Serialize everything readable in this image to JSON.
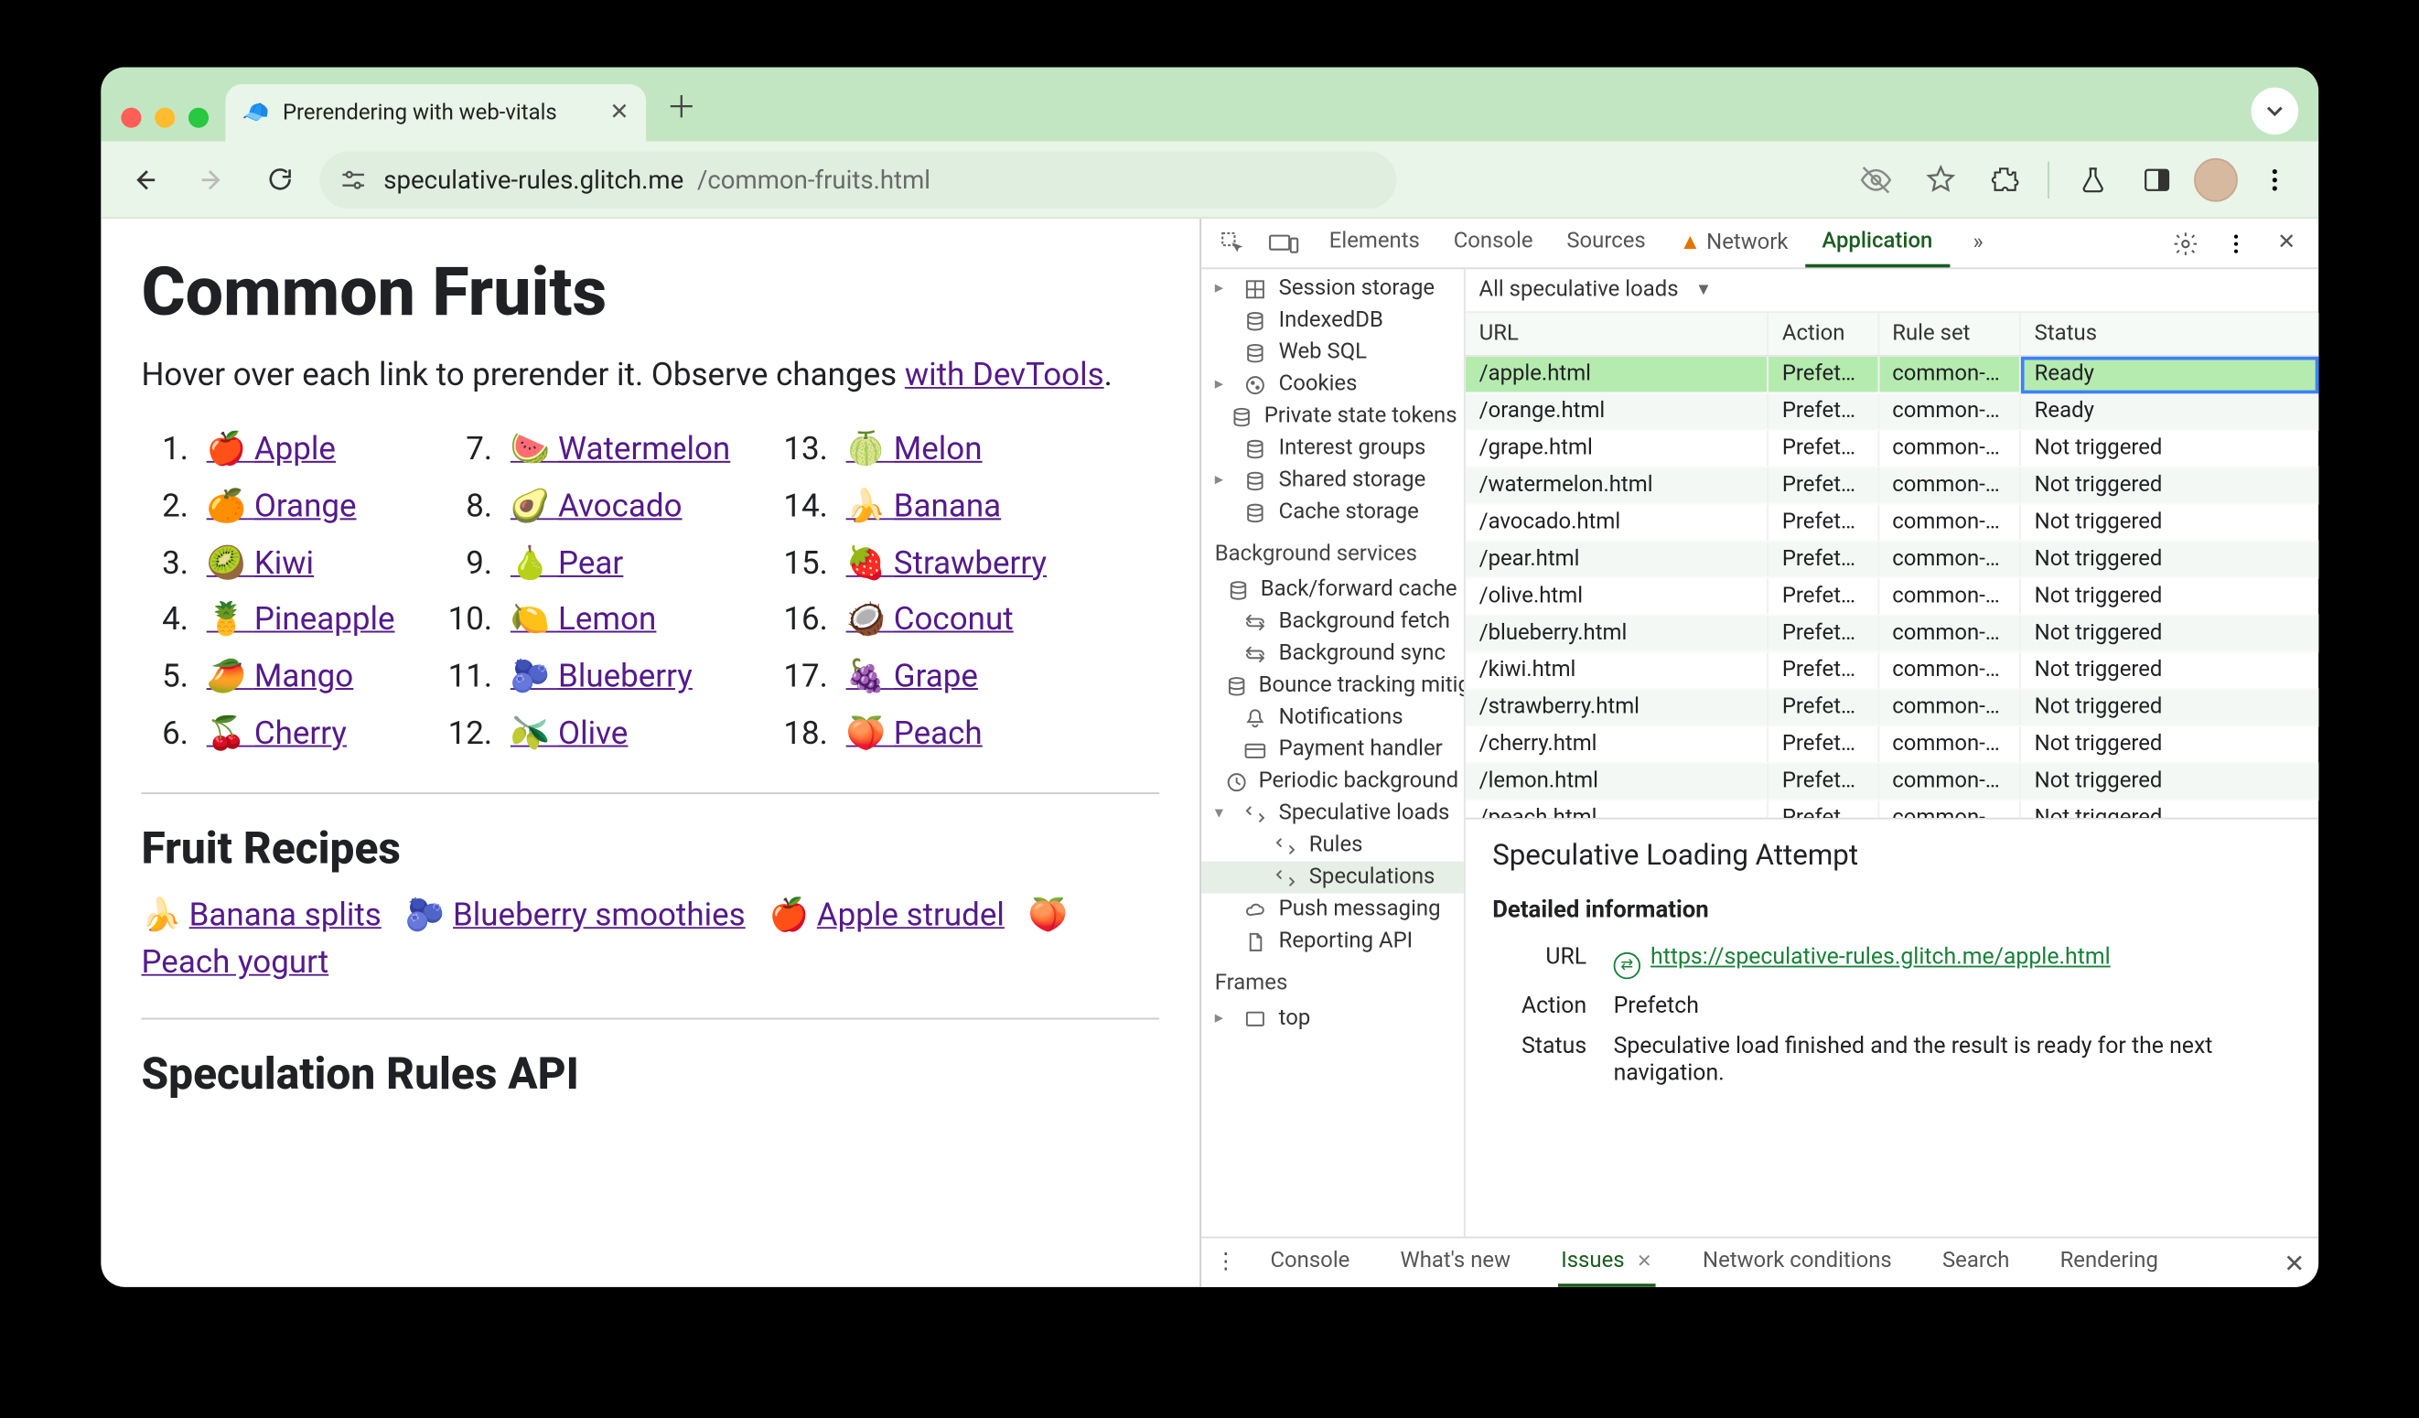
{
  "tab": {
    "title": "Prerendering with web-vitals",
    "favicon": "🧢"
  },
  "omnibox": {
    "site": "speculative-rules.glitch.me",
    "path": "/common-fruits.html"
  },
  "page": {
    "h1": "Common Fruits",
    "lead_prefix": "Hover over each link to prerender it. Observe changes ",
    "lead_link": "with DevTools",
    "lead_suffix": ".",
    "recipes_heading": "Fruit Recipes",
    "spec_heading": "Speculation Rules API",
    "fruits": [
      {
        "n": "1.",
        "e": "🍎",
        "t": "Apple"
      },
      {
        "n": "2.",
        "e": "🍊",
        "t": "Orange"
      },
      {
        "n": "3.",
        "e": "🥝",
        "t": "Kiwi"
      },
      {
        "n": "4.",
        "e": "🍍",
        "t": "Pineapple"
      },
      {
        "n": "5.",
        "e": "🥭",
        "t": "Mango"
      },
      {
        "n": "6.",
        "e": "🍒",
        "t": "Cherry"
      },
      {
        "n": "7.",
        "e": "🍉",
        "t": "Watermelon"
      },
      {
        "n": "8.",
        "e": "🥑",
        "t": "Avocado"
      },
      {
        "n": "9.",
        "e": "🍐",
        "t": "Pear"
      },
      {
        "n": "10.",
        "e": "🍋",
        "t": "Lemon"
      },
      {
        "n": "11.",
        "e": "🫐",
        "t": "Blueberry"
      },
      {
        "n": "12.",
        "e": "🫒",
        "t": "Olive"
      },
      {
        "n": "13.",
        "e": "🍈",
        "t": "Melon"
      },
      {
        "n": "14.",
        "e": "🍌",
        "t": "Banana"
      },
      {
        "n": "15.",
        "e": "🍓",
        "t": "Strawberry"
      },
      {
        "n": "16.",
        "e": "🥥",
        "t": "Coconut"
      },
      {
        "n": "17.",
        "e": "🍇",
        "t": "Grape"
      },
      {
        "n": "18.",
        "e": "🍑",
        "t": "Peach"
      }
    ],
    "recipes": [
      {
        "e": "🍌",
        "t": "Banana splits"
      },
      {
        "e": "🫐",
        "t": "Blueberry smoothies"
      },
      {
        "e": "🍎",
        "t": "Apple strudel"
      },
      {
        "e": "🍑",
        "t": "Peach yogurt"
      }
    ]
  },
  "devtools": {
    "tabs": [
      "Elements",
      "Console",
      "Sources",
      "Network",
      "Application"
    ],
    "active_tab": "Application",
    "network_warning": true,
    "sidebar_storage": [
      {
        "caret": "▸",
        "icon": "grid",
        "label": "Session storage"
      },
      {
        "caret": "",
        "icon": "db",
        "label": "IndexedDB"
      },
      {
        "caret": "",
        "icon": "db",
        "label": "Web SQL"
      },
      {
        "caret": "▸",
        "icon": "cookie",
        "label": "Cookies"
      },
      {
        "caret": "",
        "icon": "db",
        "label": "Private state tokens"
      },
      {
        "caret": "",
        "icon": "db",
        "label": "Interest groups"
      },
      {
        "caret": "▸",
        "icon": "db",
        "label": "Shared storage"
      },
      {
        "caret": "",
        "icon": "db",
        "label": "Cache storage"
      }
    ],
    "bg_heading": "Background services",
    "sidebar_bg": [
      {
        "icon": "db",
        "label": "Back/forward cache"
      },
      {
        "icon": "sync",
        "label": "Background fetch"
      },
      {
        "icon": "sync",
        "label": "Background sync"
      },
      {
        "icon": "db",
        "label": "Bounce tracking mitigation"
      },
      {
        "icon": "bell",
        "label": "Notifications"
      },
      {
        "icon": "card",
        "label": "Payment handler"
      },
      {
        "icon": "clock",
        "label": "Periodic background sync"
      },
      {
        "icon": "spec",
        "label": "Speculative loads",
        "caret": "▾"
      },
      {
        "icon": "spec",
        "label": "Rules",
        "indent": true
      },
      {
        "icon": "spec",
        "label": "Speculations",
        "indent": true,
        "selected": true
      },
      {
        "icon": "cloud",
        "label": "Push messaging"
      },
      {
        "icon": "doc",
        "label": "Reporting API"
      }
    ],
    "frames_heading": "Frames",
    "frames": [
      {
        "caret": "▸",
        "icon": "frame",
        "label": "top"
      }
    ],
    "filter_label": "All speculative loads",
    "columns": [
      "URL",
      "Action",
      "Rule set",
      "Status"
    ],
    "col_widths": [
      "170",
      "62",
      "80",
      "168"
    ],
    "rows": [
      {
        "url": "/apple.html",
        "action": "Prefetch",
        "ruleset": "common-…",
        "status": "Ready",
        "selected": true
      },
      {
        "url": "/orange.html",
        "action": "Prefetch",
        "ruleset": "common-…",
        "status": "Ready"
      },
      {
        "url": "/grape.html",
        "action": "Prefetch",
        "ruleset": "common-…",
        "status": "Not triggered"
      },
      {
        "url": "/watermelon.html",
        "action": "Prefetch",
        "ruleset": "common-…",
        "status": "Not triggered"
      },
      {
        "url": "/avocado.html",
        "action": "Prefetch",
        "ruleset": "common-…",
        "status": "Not triggered"
      },
      {
        "url": "/pear.html",
        "action": "Prefetch",
        "ruleset": "common-…",
        "status": "Not triggered"
      },
      {
        "url": "/olive.html",
        "action": "Prefetch",
        "ruleset": "common-…",
        "status": "Not triggered"
      },
      {
        "url": "/blueberry.html",
        "action": "Prefetch",
        "ruleset": "common-…",
        "status": "Not triggered"
      },
      {
        "url": "/kiwi.html",
        "action": "Prefetch",
        "ruleset": "common-…",
        "status": "Not triggered"
      },
      {
        "url": "/strawberry.html",
        "action": "Prefetch",
        "ruleset": "common-…",
        "status": "Not triggered"
      },
      {
        "url": "/cherry.html",
        "action": "Prefetch",
        "ruleset": "common-…",
        "status": "Not triggered"
      },
      {
        "url": "/lemon.html",
        "action": "Prefetch",
        "ruleset": "common-…",
        "status": "Not triggered"
      },
      {
        "url": "/peach.html",
        "action": "Prefetch",
        "ruleset": "common-…",
        "status": "Not triggered"
      }
    ],
    "detail": {
      "title": "Speculative Loading Attempt",
      "subheading": "Detailed information",
      "url_label": "URL",
      "url": "https://speculative-rules.glitch.me/apple.html",
      "action_label": "Action",
      "action": "Prefetch",
      "status_label": "Status",
      "status": "Speculative load finished and the result is ready for the next navigation."
    },
    "drawer": [
      "Console",
      "What's new",
      "Issues",
      "Network conditions",
      "Search",
      "Rendering"
    ],
    "drawer_active": "Issues"
  }
}
